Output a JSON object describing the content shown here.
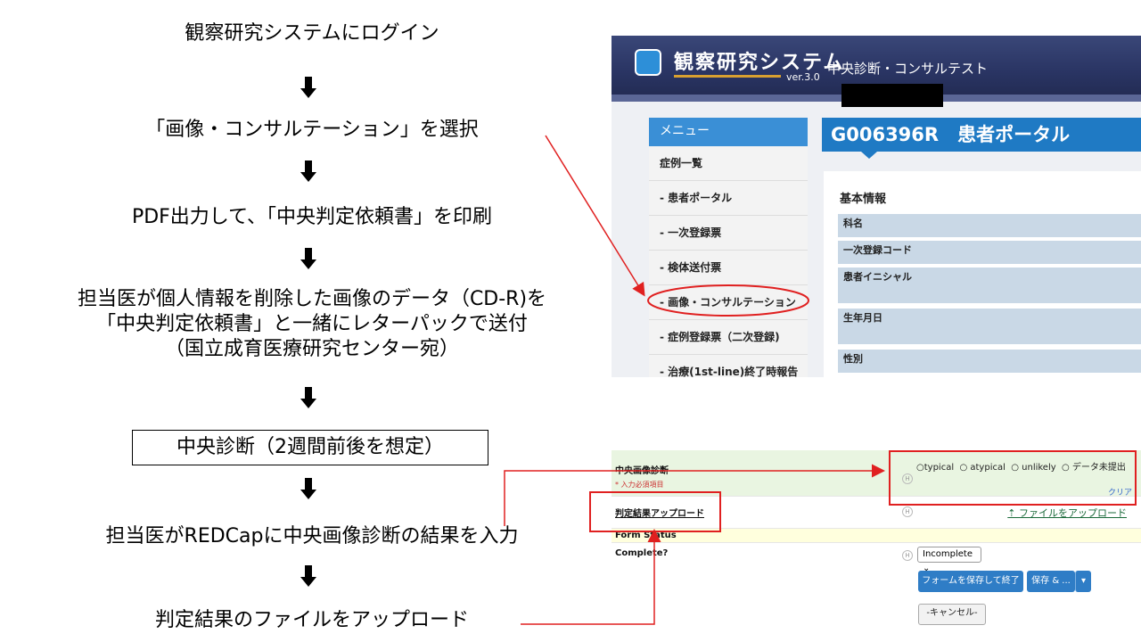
{
  "flow": {
    "step1": "観察研究システムにログイン",
    "step2": "「画像・コンサルテーション」を選択",
    "step3": "PDF出力して、「中央判定依頼書」を印刷",
    "step4_line1": "担当医が個人情報を削除した画像のデータ（CD-R)を",
    "step4_line2": "「中央判定依頼書」と一緒にレターパックで送付",
    "step4_line3": "（国立成育医療研究センター宛）",
    "step5": "中央診断（2週間前後を想定）",
    "step6": "担当医がREDCapに中央画像診断の結果を入力",
    "step7": "判定結果のファイルをアップロード"
  },
  "system": {
    "logo": "観察研究システム",
    "version": "ver.3.0",
    "subtitle": "中央診断・コンサルテスト",
    "menu_title": "メニュー",
    "menu_items": [
      "症例一覧",
      "- 患者ポータル",
      "- 一次登録票",
      "- 検体送付票",
      "- 画像・コンサルテーション",
      "- 症例登録票（二次登録)",
      "- 治療(1st-line)終了時報告"
    ],
    "portal_title": "G006396R　患者ポータル",
    "section": "基本情報",
    "fields": [
      "科名",
      "一次登録コード",
      "患者イニシャル",
      "生年月日",
      "性別"
    ]
  },
  "redcap": {
    "field_label": "中央画像診断",
    "required_note": "* 入力必須項目",
    "options": [
      "typical",
      "atypical",
      "unlikely",
      "データ未提出"
    ],
    "clear": "クリア",
    "upload_label": "判定結果アップロード",
    "upload_link": "ファイルをアップロード",
    "form_status": "Form Status",
    "complete_label": "Complete?",
    "complete_value": "Incomplete",
    "save_exit": "フォームを保存して終了",
    "save_more": "保存 & ...",
    "cancel": "-キャンセル-"
  },
  "colors": {
    "annotation": "#e02020",
    "accent": "#1f7ac4"
  }
}
